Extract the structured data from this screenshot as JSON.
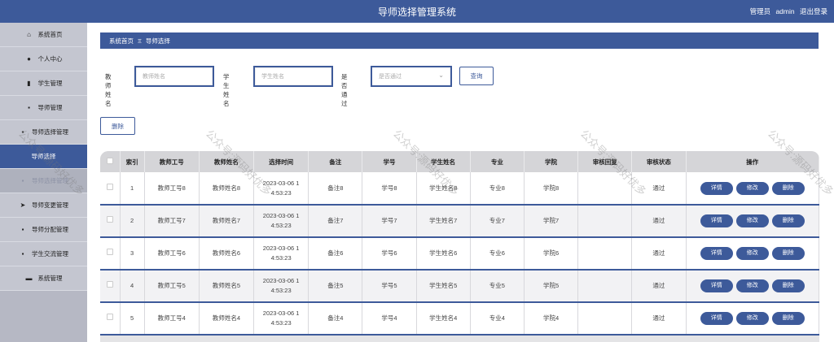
{
  "header": {
    "title": "导师选择管理系统",
    "role": "管理员",
    "user": "admin",
    "logout": "退出登录"
  },
  "sidebar": {
    "items": [
      {
        "icon": "home-icon",
        "glyph": "⌂",
        "label": "系统首页"
      },
      {
        "icon": "user-icon",
        "glyph": "●",
        "label": "个人中心"
      },
      {
        "icon": "bars-icon",
        "glyph": "▮",
        "label": "学生管理"
      },
      {
        "icon": "grid-icon",
        "glyph": "▪",
        "label": "导师管理"
      },
      {
        "icon": "grid-icon",
        "glyph": "▪",
        "label": "导师选择管理"
      },
      {
        "icon": "",
        "glyph": "",
        "label": "导师选择"
      },
      {
        "icon": "grid-icon",
        "glyph": "▪",
        "label": "导师选择管理"
      },
      {
        "icon": "send-icon",
        "glyph": "➤",
        "label": "导师变更管理"
      },
      {
        "icon": "grid-icon",
        "glyph": "▪",
        "label": "导师分配管理"
      },
      {
        "icon": "grid-icon",
        "glyph": "▪",
        "label": "学生交流管理"
      },
      {
        "icon": "briefcase-icon",
        "glyph": "▬",
        "label": "系统管理"
      }
    ]
  },
  "breadcrumb": {
    "home": "系统首页",
    "separator": "Ξ",
    "current": "导师选择"
  },
  "filters": {
    "teacher_name_label": "教师姓名",
    "teacher_name_placeholder": "教师姓名",
    "student_name_label": "学生姓名",
    "student_name_placeholder": "学生姓名",
    "approved_label": "是否通过",
    "approved_placeholder": "是否通过",
    "query_button": "查询"
  },
  "delete_button": "删除",
  "table": {
    "columns": [
      "",
      "索引",
      "教师工号",
      "教师姓名",
      "选择时间",
      "备注",
      "学号",
      "学生姓名",
      "专业",
      "学院",
      "审核回复",
      "审核状态",
      "操作"
    ],
    "actions": {
      "detail": "详情",
      "edit": "修改",
      "delete": "删除"
    },
    "rows": [
      {
        "index": "1",
        "teacher_id": "教师工号8",
        "teacher_name": "教师姓名8",
        "time_a": "2023-03-06 1",
        "time_b": "4:53:23",
        "note": "备注8",
        "student_id": "学号8",
        "student_name": "学生姓名8",
        "major": "专业8",
        "college": "学院8",
        "reply": "",
        "status": "通过"
      },
      {
        "index": "2",
        "teacher_id": "教师工号7",
        "teacher_name": "教师姓名7",
        "time_a": "2023-03-06 1",
        "time_b": "4:53:23",
        "note": "备注7",
        "student_id": "学号7",
        "student_name": "学生姓名7",
        "major": "专业7",
        "college": "学院7",
        "reply": "",
        "status": "通过"
      },
      {
        "index": "3",
        "teacher_id": "教师工号6",
        "teacher_name": "教师姓名6",
        "time_a": "2023-03-06 1",
        "time_b": "4:53:23",
        "note": "备注6",
        "student_id": "学号6",
        "student_name": "学生姓名6",
        "major": "专业6",
        "college": "学院6",
        "reply": "",
        "status": "通过"
      },
      {
        "index": "4",
        "teacher_id": "教师工号5",
        "teacher_name": "教师姓名5",
        "time_a": "2023-03-06 1",
        "time_b": "4:53:23",
        "note": "备注5",
        "student_id": "学号5",
        "student_name": "学生姓名5",
        "major": "专业5",
        "college": "学院5",
        "reply": "",
        "status": "通过"
      },
      {
        "index": "5",
        "teacher_id": "教师工号4",
        "teacher_name": "教师姓名4",
        "time_a": "2023-03-06 1",
        "time_b": "4:53:23",
        "note": "备注4",
        "student_id": "学号4",
        "student_name": "学生姓名4",
        "major": "专业4",
        "college": "学院4",
        "reply": "",
        "status": "通过"
      }
    ]
  },
  "watermark": "公众号:源码好优多",
  "colors": {
    "primary": "#3d5a9a",
    "sidebar": "#c4c6d0",
    "header_row": "#d5d5d8"
  }
}
